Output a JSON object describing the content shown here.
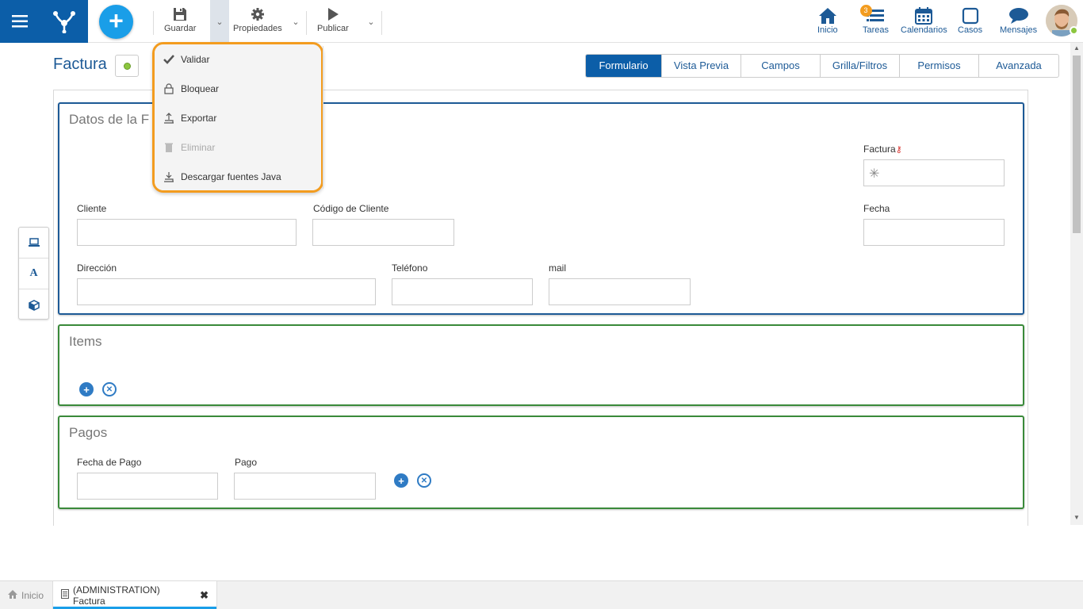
{
  "toolbar": {
    "save_label": "Guardar",
    "properties_label": "Propiedades",
    "publish_label": "Publicar"
  },
  "nav": {
    "home": "Inicio",
    "tasks": "Tareas",
    "tasks_badge": "3",
    "calendars": "Calendarios",
    "cases": "Casos",
    "messages": "Mensajes"
  },
  "page": {
    "title": "Factura"
  },
  "tabs": [
    "Formulario",
    "Vista Previa",
    "Campos",
    "Grilla/Filtros",
    "Permisos",
    "Avanzada"
  ],
  "dropdown": {
    "items": [
      "Validar",
      "Bloquear",
      "Exportar",
      "Eliminar",
      "Descargar fuentes Java"
    ]
  },
  "sections": {
    "datos": {
      "title": "Datos de la F",
      "factura_label": "Factura",
      "fecha_label": "Fecha",
      "cliente_label": "Cliente",
      "codigo_label": "Código de Cliente",
      "direccion_label": "Dirección",
      "telefono_label": "Teléfono",
      "mail_label": "mail"
    },
    "items": {
      "title": "Items"
    },
    "pagos": {
      "title": "Pagos",
      "fecha_pago_label": "Fecha de Pago",
      "pago_label": "Pago"
    }
  },
  "bottom_tabs": {
    "home": "Inicio",
    "doc": "(ADMINISTRATION) Factura"
  },
  "colors": {
    "brand": "#0c5ea8",
    "accent": "#1a9ee8",
    "highlight": "#f39c1f",
    "section_blue": "#1d5a96",
    "section_green": "#3a8a3a"
  }
}
